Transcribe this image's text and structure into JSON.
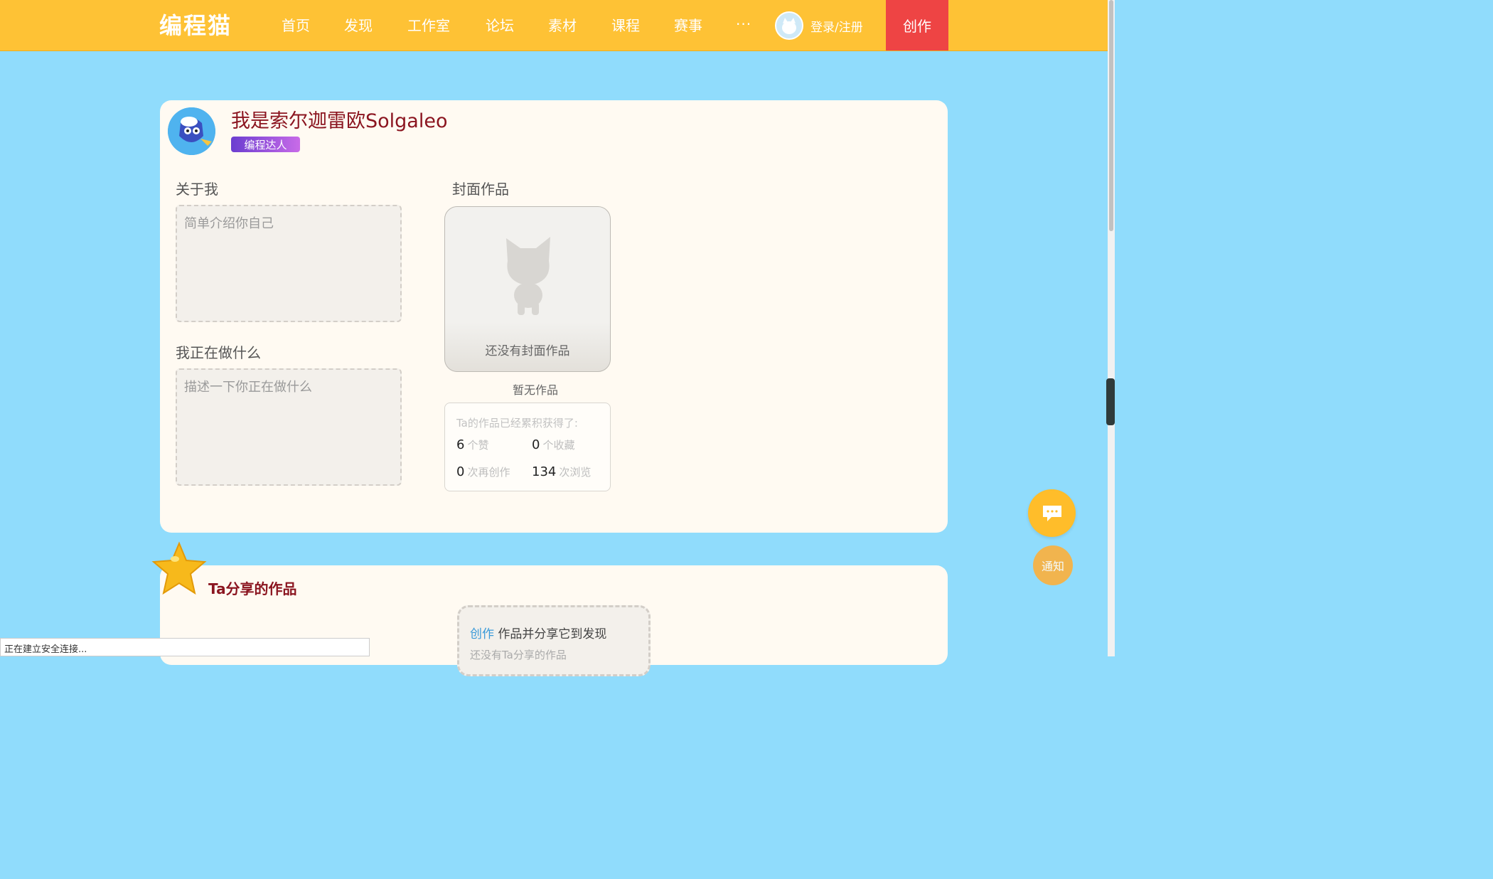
{
  "nav": {
    "logo": "编程猫",
    "items": [
      {
        "label": "首页"
      },
      {
        "label": "发现"
      },
      {
        "label": "工作室"
      },
      {
        "label": "论坛"
      },
      {
        "label": "素材"
      },
      {
        "label": "课程"
      },
      {
        "label": "赛事"
      }
    ],
    "more": "···",
    "login": "登录/注册",
    "create": "创作"
  },
  "profile": {
    "username": "我是索尔迦雷欧Solgaleo",
    "badge": "编程达人",
    "about_label": "关于我",
    "about_placeholder": "简单介绍你自己",
    "doing_label": "我正在做什么",
    "doing_placeholder": "描述一下你正在做什么",
    "cover_label": "封面作品",
    "cover_empty": "还没有封面作品",
    "no_work": "暂无作品",
    "stats_title": "Ta的作品已经累积获得了:",
    "stats": {
      "likes": {
        "value": "6",
        "unit": "个赞"
      },
      "favorites": {
        "value": "0",
        "unit": "个收藏"
      },
      "remixes": {
        "value": "0",
        "unit": "次再创作"
      },
      "views": {
        "value": "134",
        "unit": "次浏览"
      }
    }
  },
  "shared": {
    "title": "Ta分享的作品",
    "create_link": "创作",
    "create_text": " 作品并分享它到发现",
    "empty_text": "还没有Ta分享的作品"
  },
  "floating": {
    "notify": "通知"
  },
  "status": {
    "text": "正在建立安全连接..."
  },
  "colors": {
    "background": "#90dcfc",
    "topbar": "#fec235",
    "create_button": "#ee4444",
    "username": "#8b1520"
  }
}
